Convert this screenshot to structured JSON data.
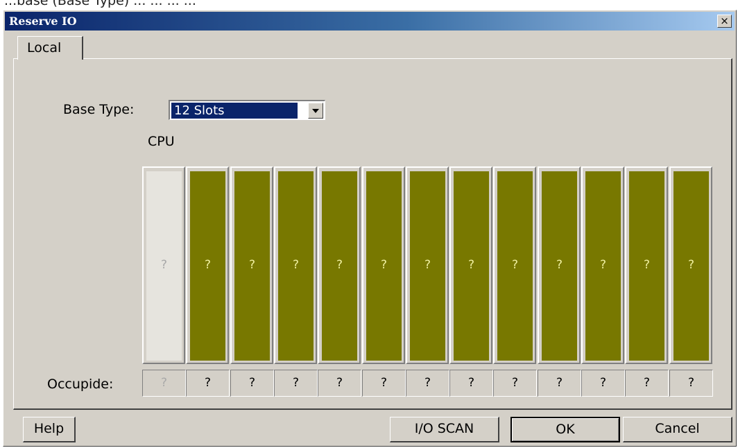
{
  "background_text": "...base (Base Type) ... ... ... ...",
  "window": {
    "title": "Reserve IO",
    "close_glyph": "×"
  },
  "tabs": [
    {
      "label": "Local"
    }
  ],
  "base_type": {
    "label": "Base Type:",
    "selected": "12 Slots"
  },
  "cpu_label": "CPU",
  "slots": [
    "?",
    "?",
    "?",
    "?",
    "?",
    "?",
    "?",
    "?",
    "?",
    "?",
    "?",
    "?",
    "?"
  ],
  "occupied": {
    "label": "Occupide:",
    "values": [
      "?",
      "?",
      "?",
      "?",
      "?",
      "?",
      "?",
      "?",
      "?",
      "?",
      "?",
      "?",
      "?"
    ]
  },
  "buttons": {
    "help": "Help",
    "io_scan": "I/O SCAN",
    "ok": "OK",
    "cancel": "Cancel"
  },
  "colors": {
    "slot_fill": "#787800",
    "cpu_fill": "#e6e4de",
    "title_start": "#0a246a",
    "title_end": "#a6caf0",
    "dialog_bg": "#d4d0c8"
  }
}
